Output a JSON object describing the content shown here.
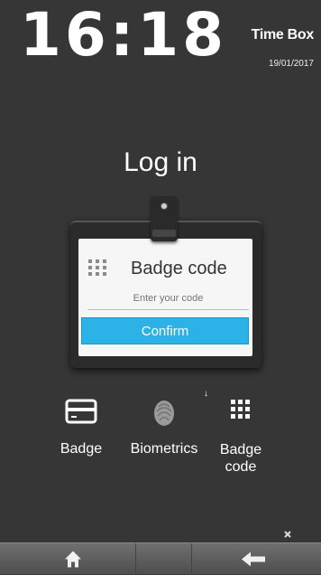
{
  "header": {
    "clock": "16:18",
    "brand": "Time Box",
    "date": "19/01/2017"
  },
  "login": {
    "title": "Log in",
    "card_title": "Badge code",
    "code_placeholder": "Enter your code",
    "confirm_label": "Confirm"
  },
  "options": [
    {
      "label": "Badge",
      "icon": "badge-card-icon"
    },
    {
      "label": "Biometrics",
      "icon": "fingerprint-icon"
    },
    {
      "label": "Badge code",
      "label_line1": "Badge",
      "label_line2": "code",
      "icon": "keypad-icon",
      "selected_marker": "↓"
    }
  ],
  "footer": {
    "pin_icon": "pin-icon",
    "home_icon": "home-icon",
    "back_icon": "back-arrow-icon"
  },
  "colors": {
    "background": "#363636",
    "accent": "#2cb2e6",
    "card_bg": "#f6f6f6"
  }
}
